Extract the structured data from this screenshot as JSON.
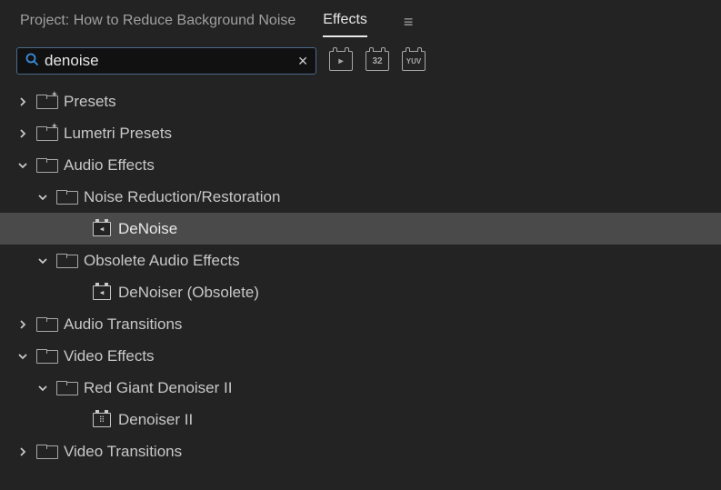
{
  "tabs": {
    "project": "Project: How to Reduce Background Noise",
    "effects": "Effects"
  },
  "search": {
    "value": "denoise"
  },
  "tree": [
    {
      "label": "Presets",
      "depth": 1,
      "expanded": false,
      "icon": "folder-star"
    },
    {
      "label": "Lumetri Presets",
      "depth": 1,
      "expanded": false,
      "icon": "folder-star"
    },
    {
      "label": "Audio Effects",
      "depth": 1,
      "expanded": true,
      "icon": "folder"
    },
    {
      "label": "Noise Reduction/Restoration",
      "depth": 2,
      "expanded": true,
      "icon": "folder"
    },
    {
      "label": "DeNoise",
      "depth": 3,
      "leaf": true,
      "selected": true,
      "icon": "fx-audio"
    },
    {
      "label": "Obsolete Audio Effects",
      "depth": 2,
      "expanded": true,
      "icon": "folder"
    },
    {
      "label": "DeNoiser (Obsolete)",
      "depth": 3,
      "leaf": true,
      "icon": "fx-audio"
    },
    {
      "label": "Audio Transitions",
      "depth": 1,
      "expanded": false,
      "icon": "folder"
    },
    {
      "label": "Video Effects",
      "depth": 1,
      "expanded": true,
      "icon": "folder"
    },
    {
      "label": "Red Giant Denoiser II",
      "depth": 2,
      "expanded": true,
      "icon": "folder"
    },
    {
      "label": "Denoiser II",
      "depth": 3,
      "leaf": true,
      "icon": "fx-video"
    },
    {
      "label": "Video Transitions",
      "depth": 1,
      "expanded": false,
      "icon": "folder"
    }
  ]
}
